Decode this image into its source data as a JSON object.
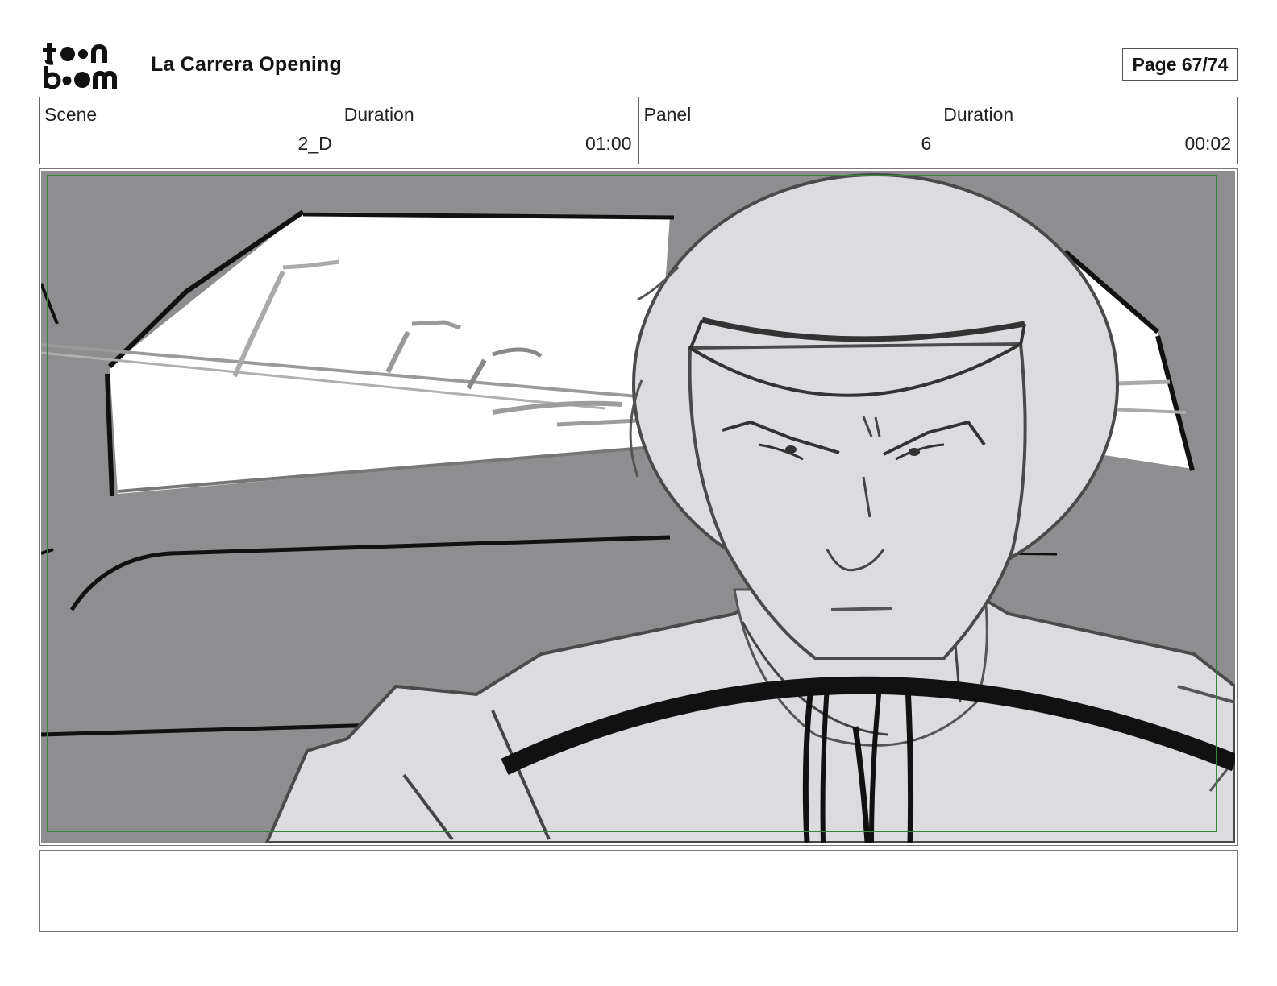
{
  "header": {
    "logo": "toon-boom-logo",
    "title": "La Carrera Opening",
    "page_label": "Page 67/74"
  },
  "info": {
    "scene_label": "Scene",
    "scene_value": "2_D",
    "scene_duration_label": "Duration",
    "scene_duration_value": "01:00",
    "panel_label": "Panel",
    "panel_value": "6",
    "panel_duration_label": "Duration",
    "panel_duration_value": "00:02"
  },
  "panel": {
    "image": "storyboard-sketch-driver-with-helmet-at-steering-wheel",
    "safe_frame_color": "#3f7f3f"
  },
  "notes": {
    "text": ""
  }
}
